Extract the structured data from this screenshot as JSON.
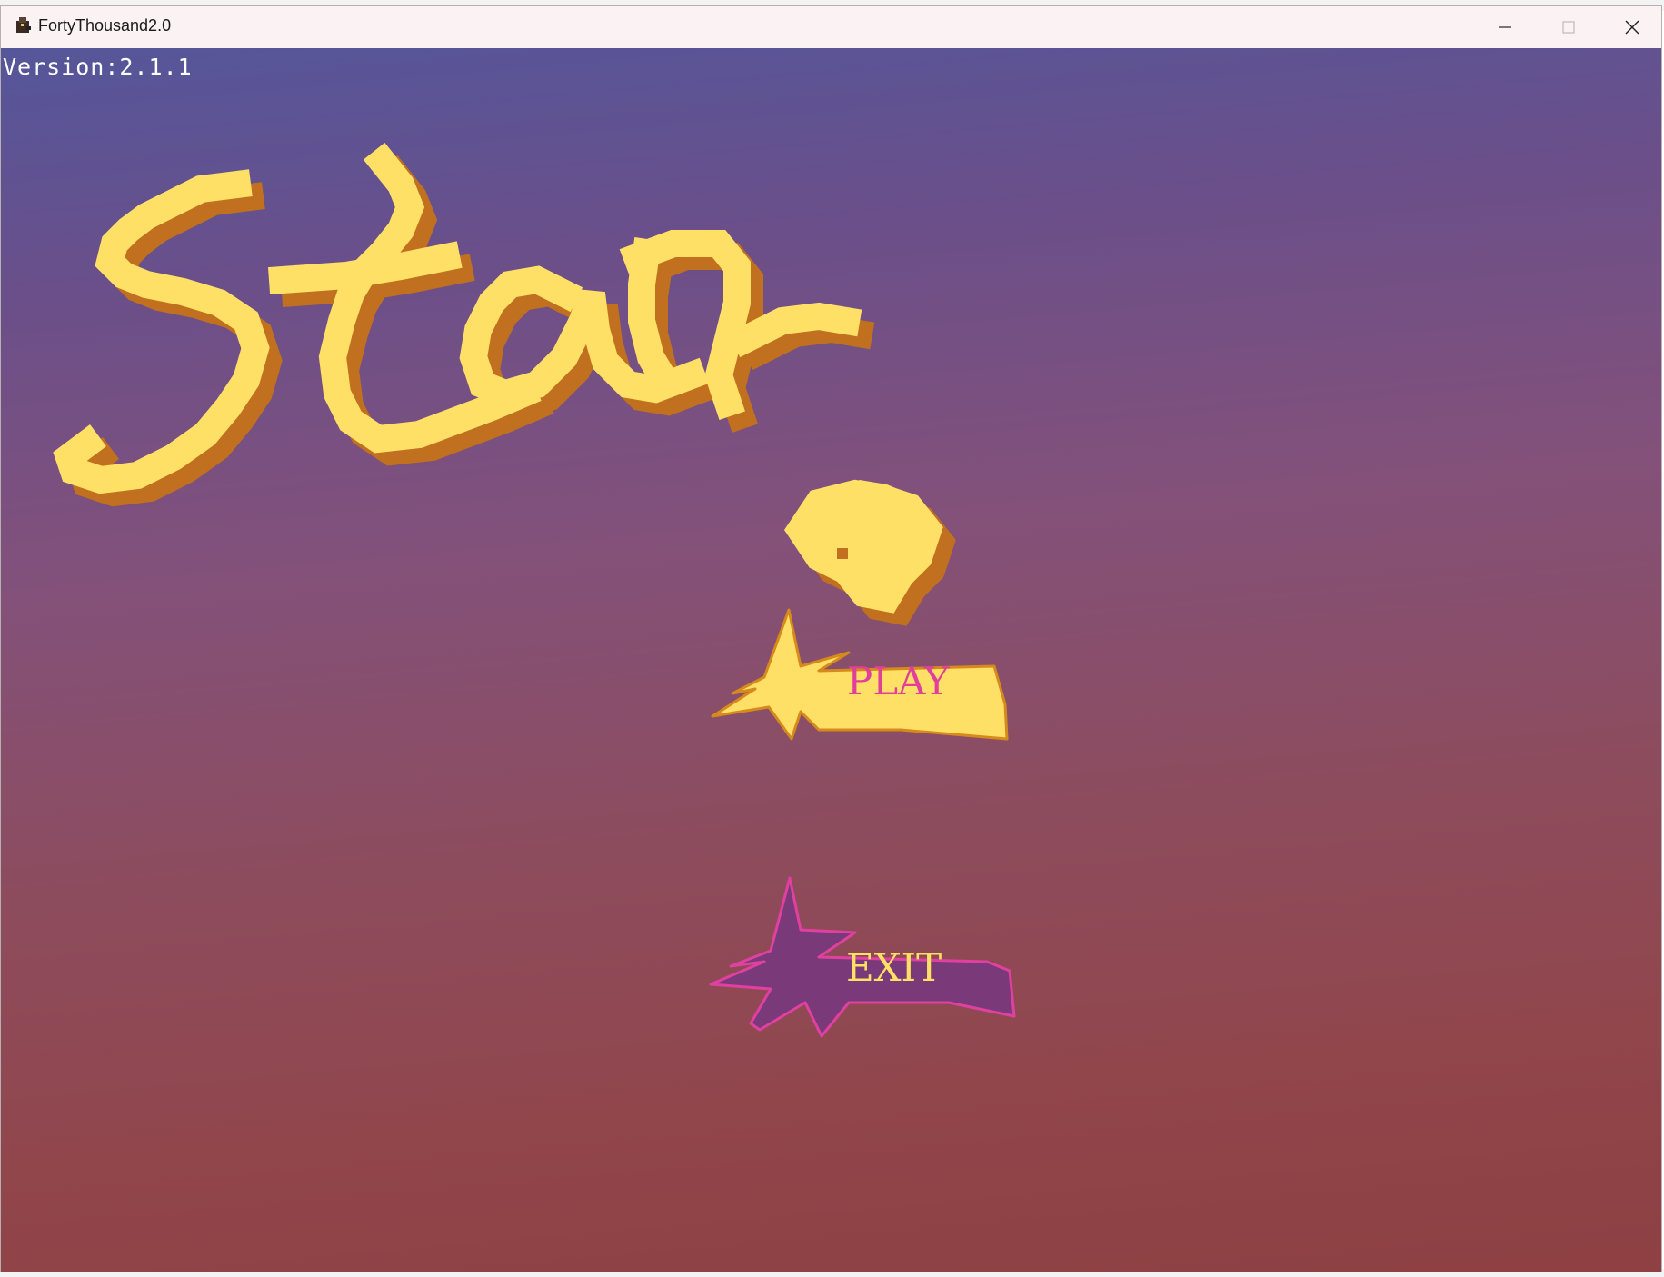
{
  "window": {
    "title": "FortyThousand2.0",
    "minimize_label": "—",
    "maximize_label": "☐",
    "close_label": "✕"
  },
  "game": {
    "version_text": "Version:2.1.1",
    "logo_text": "Star",
    "play_label": "PLAY",
    "exit_label": "EXIT"
  },
  "colors": {
    "background_top": "#55569a",
    "background_bottom": "#8e4042",
    "logo_fill": "#ffe066",
    "logo_shadow": "#c0701e",
    "play_fill": "#ffe066",
    "play_outline": "#d68a1c",
    "play_text": "#e0409a",
    "exit_fill": "#7a3a7a",
    "exit_outline": "#e040a0",
    "exit_text": "#ffe066"
  },
  "icons": {
    "app": "game-app-icon",
    "minimize": "minimize-icon",
    "maximize": "maximize-icon",
    "close": "close-icon"
  }
}
